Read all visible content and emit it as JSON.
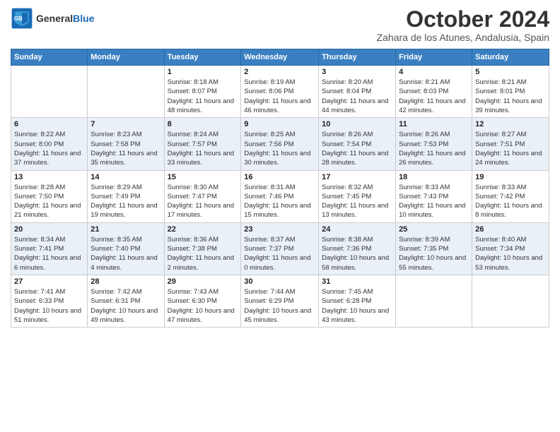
{
  "header": {
    "logo_line1": "General",
    "logo_line2": "Blue",
    "month": "October 2024",
    "location": "Zahara de los Atunes, Andalusia, Spain"
  },
  "columns": [
    "Sunday",
    "Monday",
    "Tuesday",
    "Wednesday",
    "Thursday",
    "Friday",
    "Saturday"
  ],
  "weeks": [
    [
      {
        "day": "",
        "info": ""
      },
      {
        "day": "",
        "info": ""
      },
      {
        "day": "1",
        "info": "Sunrise: 8:18 AM\nSunset: 8:07 PM\nDaylight: 11 hours and 48 minutes."
      },
      {
        "day": "2",
        "info": "Sunrise: 8:19 AM\nSunset: 8:06 PM\nDaylight: 11 hours and 46 minutes."
      },
      {
        "day": "3",
        "info": "Sunrise: 8:20 AM\nSunset: 8:04 PM\nDaylight: 11 hours and 44 minutes."
      },
      {
        "day": "4",
        "info": "Sunrise: 8:21 AM\nSunset: 8:03 PM\nDaylight: 11 hours and 42 minutes."
      },
      {
        "day": "5",
        "info": "Sunrise: 8:21 AM\nSunset: 8:01 PM\nDaylight: 11 hours and 39 minutes."
      }
    ],
    [
      {
        "day": "6",
        "info": "Sunrise: 8:22 AM\nSunset: 8:00 PM\nDaylight: 11 hours and 37 minutes."
      },
      {
        "day": "7",
        "info": "Sunrise: 8:23 AM\nSunset: 7:58 PM\nDaylight: 11 hours and 35 minutes."
      },
      {
        "day": "8",
        "info": "Sunrise: 8:24 AM\nSunset: 7:57 PM\nDaylight: 11 hours and 33 minutes."
      },
      {
        "day": "9",
        "info": "Sunrise: 8:25 AM\nSunset: 7:56 PM\nDaylight: 11 hours and 30 minutes."
      },
      {
        "day": "10",
        "info": "Sunrise: 8:26 AM\nSunset: 7:54 PM\nDaylight: 11 hours and 28 minutes."
      },
      {
        "day": "11",
        "info": "Sunrise: 8:26 AM\nSunset: 7:53 PM\nDaylight: 11 hours and 26 minutes."
      },
      {
        "day": "12",
        "info": "Sunrise: 8:27 AM\nSunset: 7:51 PM\nDaylight: 11 hours and 24 minutes."
      }
    ],
    [
      {
        "day": "13",
        "info": "Sunrise: 8:28 AM\nSunset: 7:50 PM\nDaylight: 11 hours and 21 minutes."
      },
      {
        "day": "14",
        "info": "Sunrise: 8:29 AM\nSunset: 7:49 PM\nDaylight: 11 hours and 19 minutes."
      },
      {
        "day": "15",
        "info": "Sunrise: 8:30 AM\nSunset: 7:47 PM\nDaylight: 11 hours and 17 minutes."
      },
      {
        "day": "16",
        "info": "Sunrise: 8:31 AM\nSunset: 7:46 PM\nDaylight: 11 hours and 15 minutes."
      },
      {
        "day": "17",
        "info": "Sunrise: 8:32 AM\nSunset: 7:45 PM\nDaylight: 11 hours and 13 minutes."
      },
      {
        "day": "18",
        "info": "Sunrise: 8:33 AM\nSunset: 7:43 PM\nDaylight: 11 hours and 10 minutes."
      },
      {
        "day": "19",
        "info": "Sunrise: 8:33 AM\nSunset: 7:42 PM\nDaylight: 11 hours and 8 minutes."
      }
    ],
    [
      {
        "day": "20",
        "info": "Sunrise: 8:34 AM\nSunset: 7:41 PM\nDaylight: 11 hours and 6 minutes."
      },
      {
        "day": "21",
        "info": "Sunrise: 8:35 AM\nSunset: 7:40 PM\nDaylight: 11 hours and 4 minutes."
      },
      {
        "day": "22",
        "info": "Sunrise: 8:36 AM\nSunset: 7:38 PM\nDaylight: 11 hours and 2 minutes."
      },
      {
        "day": "23",
        "info": "Sunrise: 8:37 AM\nSunset: 7:37 PM\nDaylight: 11 hours and 0 minutes."
      },
      {
        "day": "24",
        "info": "Sunrise: 8:38 AM\nSunset: 7:36 PM\nDaylight: 10 hours and 58 minutes."
      },
      {
        "day": "25",
        "info": "Sunrise: 8:39 AM\nSunset: 7:35 PM\nDaylight: 10 hours and 55 minutes."
      },
      {
        "day": "26",
        "info": "Sunrise: 8:40 AM\nSunset: 7:34 PM\nDaylight: 10 hours and 53 minutes."
      }
    ],
    [
      {
        "day": "27",
        "info": "Sunrise: 7:41 AM\nSunset: 6:33 PM\nDaylight: 10 hours and 51 minutes."
      },
      {
        "day": "28",
        "info": "Sunrise: 7:42 AM\nSunset: 6:31 PM\nDaylight: 10 hours and 49 minutes."
      },
      {
        "day": "29",
        "info": "Sunrise: 7:43 AM\nSunset: 6:30 PM\nDaylight: 10 hours and 47 minutes."
      },
      {
        "day": "30",
        "info": "Sunrise: 7:44 AM\nSunset: 6:29 PM\nDaylight: 10 hours and 45 minutes."
      },
      {
        "day": "31",
        "info": "Sunrise: 7:45 AM\nSunset: 6:28 PM\nDaylight: 10 hours and 43 minutes."
      },
      {
        "day": "",
        "info": ""
      },
      {
        "day": "",
        "info": ""
      }
    ]
  ]
}
